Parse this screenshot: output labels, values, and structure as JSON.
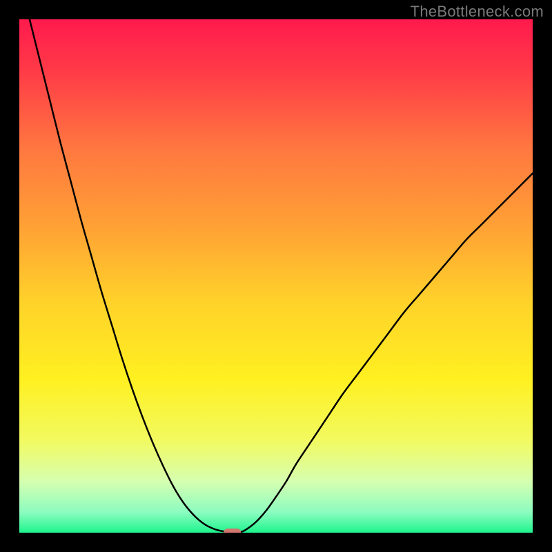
{
  "watermark": "TheBottleneck.com",
  "chart_data": {
    "type": "line",
    "title": "",
    "xlabel": "",
    "ylabel": "",
    "xlim": [
      0,
      100
    ],
    "ylim": [
      0,
      100
    ],
    "background_gradient": {
      "stops": [
        {
          "pos": 0.0,
          "color": "#ff1a4d"
        },
        {
          "pos": 0.1,
          "color": "#ff3a47"
        },
        {
          "pos": 0.25,
          "color": "#ff7740"
        },
        {
          "pos": 0.4,
          "color": "#ffa035"
        },
        {
          "pos": 0.55,
          "color": "#ffd22a"
        },
        {
          "pos": 0.7,
          "color": "#fff020"
        },
        {
          "pos": 0.82,
          "color": "#f2fa60"
        },
        {
          "pos": 0.9,
          "color": "#d6ffb0"
        },
        {
          "pos": 0.96,
          "color": "#8cfcc0"
        },
        {
          "pos": 1.0,
          "color": "#1df58d"
        }
      ]
    },
    "series": [
      {
        "name": "left_branch",
        "type": "curve",
        "color": "#000000",
        "stroke_width": 2.5,
        "x": [
          0,
          2,
          4,
          6,
          8,
          10,
          12,
          14,
          16,
          18,
          20,
          22,
          24,
          26,
          28,
          30,
          32,
          34,
          36,
          38,
          40,
          41,
          42
        ],
        "y": [
          108,
          100,
          92,
          84,
          76,
          68.5,
          61,
          54,
          47,
          40.5,
          34,
          28,
          22.5,
          17.5,
          13,
          9,
          5.8,
          3.4,
          1.7,
          0.7,
          0.2,
          0.05,
          0
        ]
      },
      {
        "name": "right_branch",
        "type": "curve",
        "color": "#000000",
        "stroke_width": 2.5,
        "x": [
          42,
          43,
          44,
          46,
          48,
          50,
          52,
          54,
          57,
          60,
          63,
          66,
          69,
          72,
          75,
          78,
          81,
          84,
          87,
          90,
          93,
          96,
          100
        ],
        "y": [
          0,
          0.1,
          0.5,
          2,
          4.2,
          7,
          10,
          13.5,
          18,
          22.5,
          27,
          31,
          35,
          39,
          43,
          46.5,
          50,
          53.5,
          57,
          60,
          63,
          66,
          70
        ]
      }
    ],
    "annotations": [
      {
        "name": "min_marker",
        "shape": "rounded_rect",
        "color": "#d1776e",
        "x": 41.5,
        "y": 0,
        "width_pct": 3.4,
        "height_pct": 1.6
      }
    ]
  }
}
